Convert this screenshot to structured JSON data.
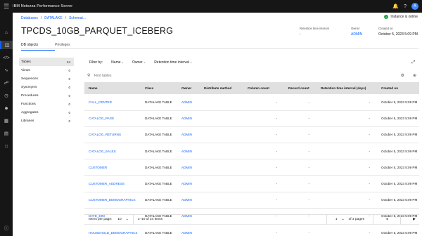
{
  "header": {
    "product": "IBM Netezza Performance Server",
    "avatar_initial": "A"
  },
  "rail": {
    "icons": [
      "home-icon",
      "database-icon",
      "code-icon",
      "activity-icon",
      "network-icon",
      "query-icon",
      "users-icon",
      "table-icon",
      "storage-icon",
      "clipboard-icon",
      "help-icon"
    ]
  },
  "breadcrumb": {
    "items": [
      "Databases",
      "DATALAKE",
      "Schemat..."
    ],
    "separator": "/"
  },
  "status": {
    "text": "Instance is online",
    "color": "#24a148"
  },
  "page": {
    "title": "TPCDS_10GB_PARQUET_ICEBERG"
  },
  "meta": {
    "retention": {
      "label": "Retention time interval",
      "value": "-"
    },
    "owner": {
      "label": "Owner",
      "value": "ADMIN"
    },
    "created": {
      "label": "Created on",
      "value": "October 5, 2023 5:09 PM"
    }
  },
  "tabs": [
    "DB objects",
    "Privileges"
  ],
  "objects": [
    {
      "label": "Tables",
      "count": "24"
    },
    {
      "label": "Views",
      "count": "0"
    },
    {
      "label": "Sequences",
      "count": "0"
    },
    {
      "label": "Synonyms",
      "count": "0"
    },
    {
      "label": "Procedures",
      "count": "0"
    },
    {
      "label": "Functions",
      "count": "0"
    },
    {
      "label": "Aggregates",
      "count": "0"
    },
    {
      "label": "Libraries",
      "count": "0"
    }
  ],
  "filters": {
    "label": "Filter by:",
    "options": [
      "Name",
      "Owner",
      "Retention time interval"
    ]
  },
  "search": {
    "placeholder": "Find tables"
  },
  "table": {
    "columns": [
      "Name",
      "Class",
      "Owner",
      "Distribute method",
      "Column count",
      "Record count",
      "Retention time interval (days)",
      "Created on"
    ],
    "rows": [
      [
        "CALL_CENTER",
        "DATALAKE TABLE",
        "ADMIN",
        "",
        "-",
        "-",
        "-",
        "October 5, 2023 5:09 PM"
      ],
      [
        "CATALOG_PAGE",
        "DATALAKE TABLE",
        "ADMIN",
        "",
        "-",
        "-",
        "-",
        "October 5, 2023 5:09 PM"
      ],
      [
        "CATALOG_RETURNS",
        "DATALAKE TABLE",
        "ADMIN",
        "",
        "-",
        "-",
        "-",
        "October 5, 2023 5:09 PM"
      ],
      [
        "CATALOG_SALES",
        "DATALAKE TABLE",
        "ADMIN",
        "",
        "-",
        "-",
        "-",
        "October 5, 2023 5:09 PM"
      ],
      [
        "CUSTOMER",
        "DATALAKE TABLE",
        "ADMIN",
        "",
        "-",
        "-",
        "-",
        "October 5, 2023 5:09 PM"
      ],
      [
        "CUSTOMER_ADDRESS",
        "DATALAKE TABLE",
        "ADMIN",
        "",
        "-",
        "-",
        "-",
        "October 5, 2023 5:09 PM"
      ],
      [
        "CUSTOMER_DEMOGRAPHICS",
        "DATALAKE TABLE",
        "ADMIN",
        "",
        "-",
        "-",
        "-",
        "October 5, 2023 5:09 PM"
      ],
      [
        "DATE_DIM",
        "DATALAKE TABLE",
        "ADMIN",
        "",
        "-",
        "-",
        "-",
        "October 5, 2023 5:09 PM"
      ],
      [
        "HOUSEHOLD_DEMOGRAPHICS",
        "DATALAKE TABLE",
        "ADMIN",
        "",
        "-",
        "-",
        "-",
        "October 5, 2023 5:09 PM"
      ]
    ]
  },
  "pagination": {
    "items_label": "Items per page:",
    "per_page": "10",
    "range": "1–10 of 24 items",
    "page": "1",
    "of_pages": "of 3 pages"
  }
}
